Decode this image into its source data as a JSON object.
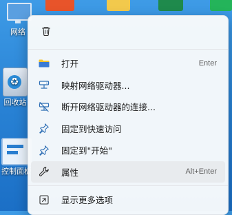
{
  "desktop": {
    "icons": [
      {
        "label": "网络"
      },
      {
        "label": "回收站"
      },
      {
        "label": "控制面板"
      }
    ]
  },
  "context_menu": {
    "quick_actions": [
      {
        "icon": "trash-icon"
      }
    ],
    "items": [
      {
        "label": "打开",
        "shortcut": "Enter",
        "icon": "folder-icon"
      },
      {
        "label": "映射网络驱动器...",
        "shortcut": "",
        "icon": "map-network-drive-icon"
      },
      {
        "label": "断开网络驱动器的连接...",
        "shortcut": "",
        "icon": "disconnect-network-drive-icon"
      },
      {
        "label": "固定到快速访问",
        "shortcut": "",
        "icon": "pin-icon"
      },
      {
        "label": "固定到\"开始\"",
        "shortcut": "",
        "icon": "pin-icon"
      },
      {
        "label": "属性",
        "shortcut": "Alt+Enter",
        "icon": "wrench-icon"
      },
      {
        "label": "显示更多选项",
        "shortcut": "",
        "icon": "more-options-icon"
      }
    ]
  },
  "colors": {
    "accent": "#0067c0",
    "hover": "#e8ebee",
    "menu_bg": "#f8fafb"
  }
}
